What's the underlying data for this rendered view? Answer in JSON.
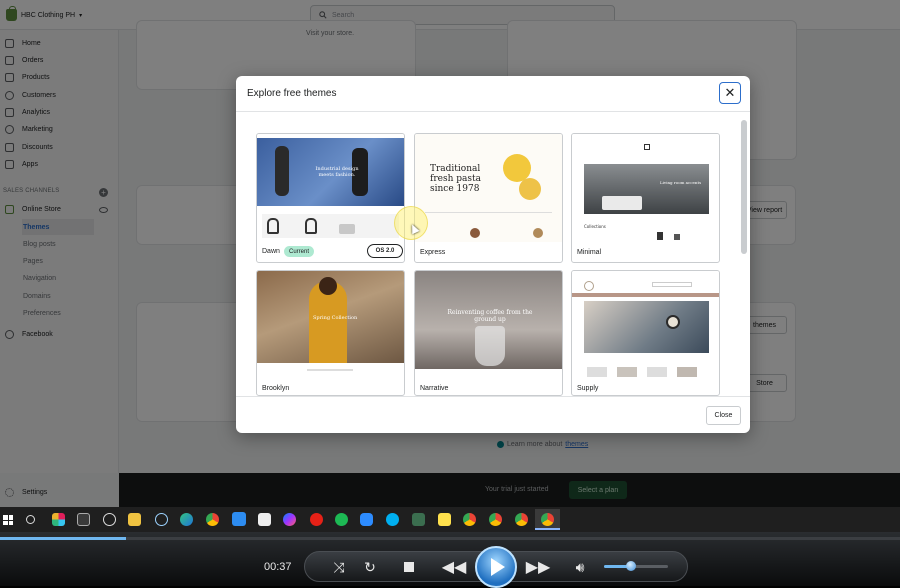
{
  "topbar": {
    "store_name": "HBC Clothing PH",
    "search_placeholder": "Search"
  },
  "sidebar": {
    "items": [
      {
        "label": "Home"
      },
      {
        "label": "Orders"
      },
      {
        "label": "Products"
      },
      {
        "label": "Customers"
      },
      {
        "label": "Analytics"
      },
      {
        "label": "Marketing"
      },
      {
        "label": "Discounts"
      },
      {
        "label": "Apps"
      }
    ],
    "sales_channels_label": "SALES CHANNELS",
    "online_store": "Online Store",
    "sub_items": [
      {
        "label": "Themes"
      },
      {
        "label": "Blog posts"
      },
      {
        "label": "Pages"
      },
      {
        "label": "Navigation"
      },
      {
        "label": "Domains"
      },
      {
        "label": "Preferences"
      }
    ],
    "facebook": "Facebook",
    "settings": "Settings"
  },
  "background": {
    "visit_store": "Visit your store.",
    "view_report": "View report",
    "explore_themes": "themes",
    "visit_store_btn": "Store",
    "learn_more_prefix": "Learn more about",
    "learn_more_link": "themes",
    "trial_text": "Your trial just started",
    "select_plan": "Select a plan"
  },
  "modal": {
    "title": "Explore free themes",
    "close_label": "Close",
    "themes": [
      {
        "name": "Dawn",
        "badge": "Current",
        "version": "OS 2.0",
        "thumb_text": "Industrial design meets fashion."
      },
      {
        "name": "Express",
        "thumb_text": "Traditional fresh pasta since 1978"
      },
      {
        "name": "Minimal",
        "thumb_text": "Living room accents",
        "thumb_sub": "Collections"
      },
      {
        "name": "Brooklyn",
        "thumb_text": "Spring Collection"
      },
      {
        "name": "Narrative",
        "thumb_text": "Reinventing coffee from the ground up"
      },
      {
        "name": "Supply"
      }
    ]
  },
  "player": {
    "time": "00:37",
    "seek_progress": 0.14,
    "volume": 0.45
  },
  "colors": {
    "accent_green": "#5e8e3e",
    "focus_blue": "#2c6ecb",
    "plan_button": "#1f5132"
  }
}
